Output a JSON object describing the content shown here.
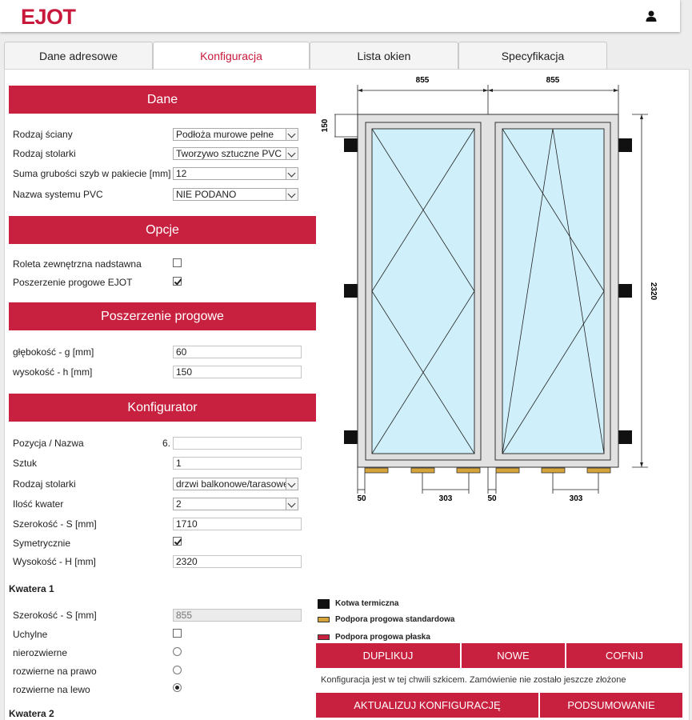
{
  "brand": {
    "logo": "EJOT",
    "accent": "#c8213f"
  },
  "tabs": [
    {
      "label": "Dane adresowe"
    },
    {
      "label": "Konfiguracja"
    },
    {
      "label": "Lista okien"
    },
    {
      "label": "Specyfikacja"
    }
  ],
  "sections": {
    "dane": "Dane",
    "opcje": "Opcje",
    "poszerzenie": "Poszerzenie progowe",
    "konfigurator": "Konfigurator"
  },
  "dane": {
    "rodzaj_sciany": {
      "label": "Rodzaj ściany",
      "value": "Podłoża murowe pełne"
    },
    "rodzaj_stolarki": {
      "label": "Rodzaj stolarki",
      "value": "Tworzywo sztuczne PVC"
    },
    "suma_grubosci": {
      "label": "Suma grubości szyb w pakiecie [mm]",
      "value": "12"
    },
    "nazwa_systemu": {
      "label": "Nazwa systemu PVC",
      "value": "NIE PODANO"
    }
  },
  "opcje": {
    "roleta": {
      "label": "Roleta zewnętrzna nadstawna",
      "checked": false
    },
    "poszerzenie": {
      "label": "Poszerzenie progowe EJOT",
      "checked": true
    }
  },
  "poszerzenie": {
    "glebokosc": {
      "label": "głębokość - g [mm]",
      "value": "60"
    },
    "wysokosc": {
      "label": "wysokość - h [mm]",
      "value": "150"
    }
  },
  "konfigurator": {
    "pozycja": {
      "label": "Pozycja / Nazwa",
      "prefix": "6.",
      "value": ""
    },
    "sztuk": {
      "label": "Sztuk",
      "value": "1"
    },
    "rodzaj_stolarki": {
      "label": "Rodzaj stolarki",
      "value": "drzwi balkonowe/tarasowe z"
    },
    "ilosc_kwater": {
      "label": "Ilość kwater",
      "value": "2"
    },
    "szerokosc": {
      "label": "Szerokość - S [mm]",
      "value": "1710"
    },
    "symetrycznie": {
      "label": "Symetrycznie",
      "checked": true
    },
    "wysokosc": {
      "label": "Wysokość - H [mm]",
      "value": "2320"
    }
  },
  "kwatera1": {
    "title": "Kwatera 1",
    "szerokosc": {
      "label": "Szerokość - S [mm]",
      "value": "855"
    },
    "uchylne": {
      "label": "Uchylne",
      "checked": false
    },
    "opening": [
      {
        "label": "nierozwierne",
        "selected": false
      },
      {
        "label": "rozwierne na prawo",
        "selected": false
      },
      {
        "label": "rozwierne na lewo",
        "selected": true
      }
    ]
  },
  "kwatera2": {
    "title": "Kwatera 2"
  },
  "drawing": {
    "dim_top_left": "855",
    "dim_top_right": "855",
    "dim_left": "150",
    "dim_right": "2320",
    "dim_bottom_a": "50",
    "dim_bottom_b": "303",
    "dim_bottom_c": "50",
    "dim_bottom_d": "303"
  },
  "legend": [
    {
      "label": "Kotwa termiczna",
      "color": "#111111"
    },
    {
      "label": "Podpora progowa standardowa",
      "color": "#d6a43a"
    },
    {
      "label": "Podpora progowa płaska",
      "color": "#c8213f"
    }
  ],
  "buttons": {
    "duplikuj": "DUPLIKUJ",
    "nowe": "NOWE",
    "cofnij": "COFNIJ",
    "aktualizuj": "AKTUALIZUJ KONFIGURACJĘ",
    "podsumowanie": "PODSUMOWANIE"
  },
  "status": "Konfiguracja jest w tej chwili szkicem. Zamówienie nie zostało jeszcze złożone"
}
